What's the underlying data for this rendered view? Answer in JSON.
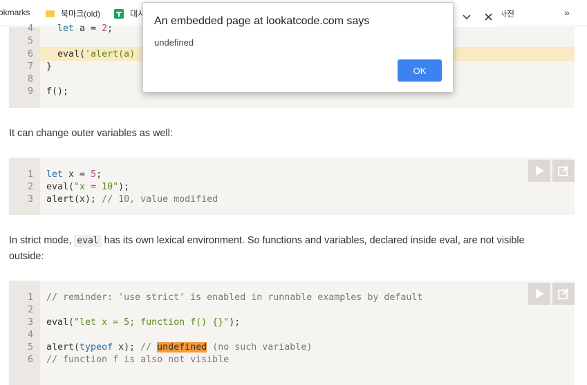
{
  "bookmarks": {
    "items": [
      {
        "label": "okmarks",
        "icon": "none"
      },
      {
        "label": "북마크(old)",
        "icon": "folder-icon"
      },
      {
        "label": "대시",
        "icon": "sheets-icon"
      },
      {
        "label": "사전",
        "icon": "none"
      }
    ],
    "overflow": "»"
  },
  "dialog": {
    "title": "An embedded page at lookatcode.com says",
    "message": "undefined",
    "ok_label": "OK"
  },
  "code1": {
    "lines": [
      {
        "n": "4",
        "text": "  let a = 2;"
      },
      {
        "n": "5",
        "text": ""
      },
      {
        "n": "6",
        "text": "  eval('alert(a)"
      },
      {
        "n": "7",
        "text": "}"
      },
      {
        "n": "8",
        "text": ""
      },
      {
        "n": "9",
        "text": "f();"
      }
    ]
  },
  "para1": "It can change outer variables as well:",
  "code2": {
    "lines": [
      {
        "n": "1",
        "text": "let x = 5;"
      },
      {
        "n": "2",
        "text": "eval(\"x = 10\");"
      },
      {
        "n": "3",
        "text": "alert(x); // 10, value modified"
      }
    ]
  },
  "para2": {
    "before": "In strict mode, ",
    "code": "eval",
    "after": " has its own lexical environment. So functions and variables, declared inside eval, are not visible outside:"
  },
  "code3": {
    "lines": [
      {
        "n": "1",
        "text": "// reminder: 'use strict' is enabled in runnable examples by default"
      },
      {
        "n": "2",
        "text": ""
      },
      {
        "n": "3",
        "text": "eval(\"let x = 5; function f() {}\");"
      },
      {
        "n": "4",
        "text": ""
      },
      {
        "n": "5",
        "text": "alert(typeof x); // undefined (no such variable)"
      },
      {
        "n": "6",
        "text": "// function f is also not visible"
      }
    ]
  },
  "colors": {
    "ok_button": "#3b84f0",
    "highlight_line": "#faeac3",
    "mark": "#f59a3b"
  }
}
